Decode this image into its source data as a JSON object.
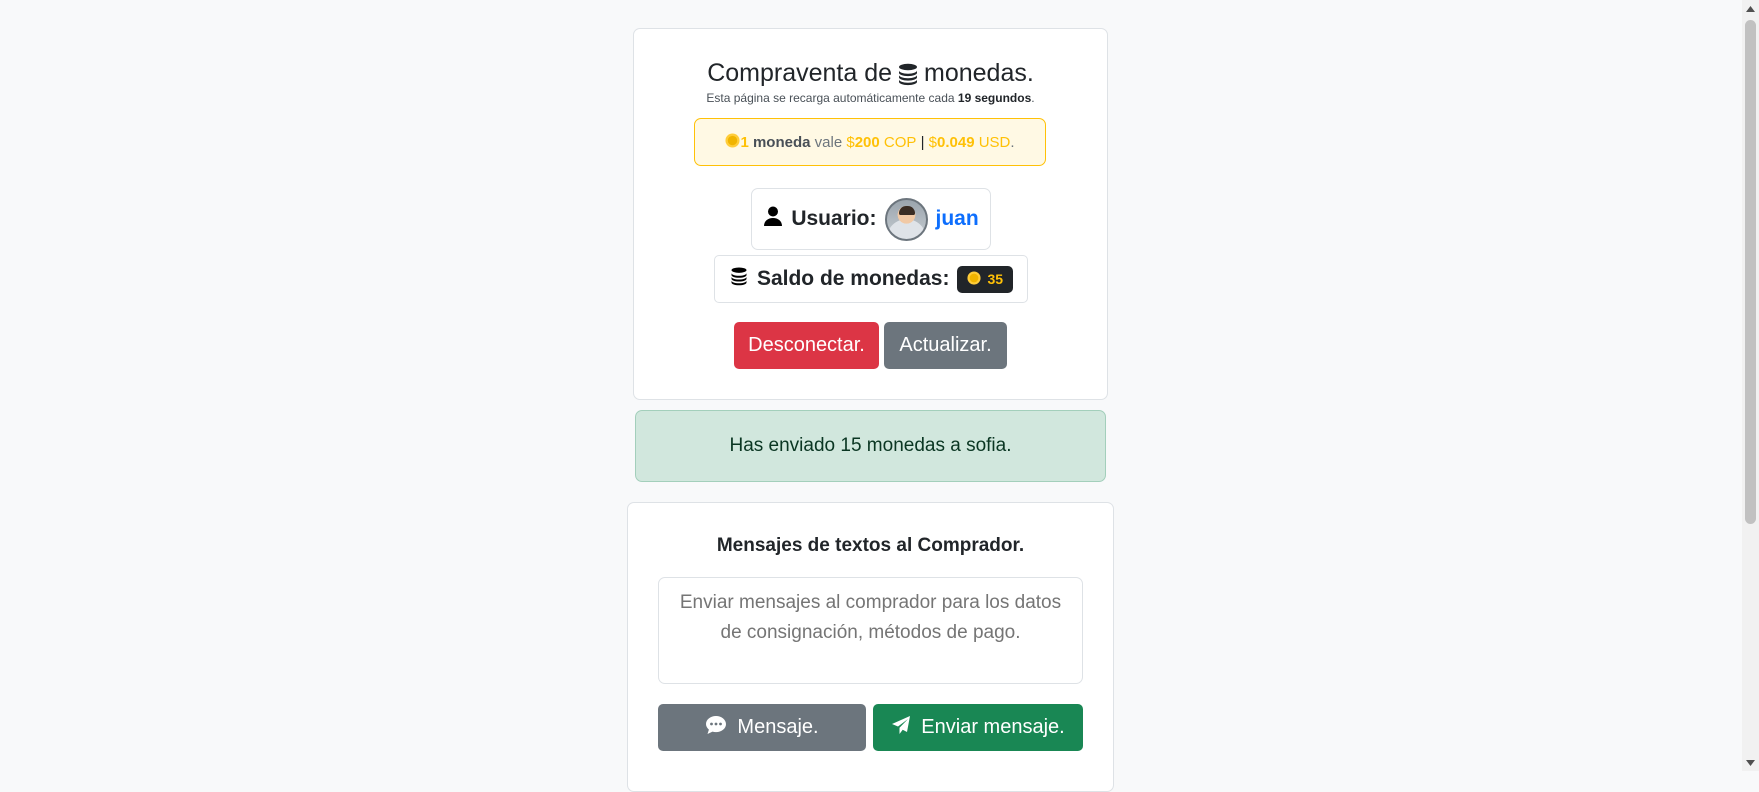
{
  "header": {
    "title_before": "Compraventa de",
    "title_after": "monedas.",
    "subtitle_before": "Esta página se recarga automáticamente cada",
    "subtitle_seconds": "19 segundos",
    "subtitle_after": "."
  },
  "price": {
    "amount": "1",
    "unit": "moneda",
    "vale": "vale",
    "cop_symbol": "$",
    "cop_value": "200",
    "cop_currency": "COP",
    "separator": "|",
    "usd_symbol": "$",
    "usd_value": "0.049",
    "usd_currency": "USD",
    "end": "."
  },
  "user": {
    "label": "Usuario:",
    "name": "juan"
  },
  "balance": {
    "label": "Saldo de monedas:",
    "value": "35"
  },
  "buttons": {
    "disconnect": "Desconectar.",
    "refresh": "Actualizar."
  },
  "alert": {
    "text": "Has enviado 15 monedas a sofia."
  },
  "messages": {
    "title": "Mensajes de textos al Comprador.",
    "placeholder": "Enviar mensajes al comprador para los datos de consignación, métodos de pago.",
    "message_button": "Mensaje.",
    "send_button": "Enviar mensaje."
  },
  "colors": {
    "danger": "#dc3545",
    "secondary": "#6c757d",
    "success": "#198754",
    "warning": "#ffc107",
    "link": "#0d6efd"
  }
}
